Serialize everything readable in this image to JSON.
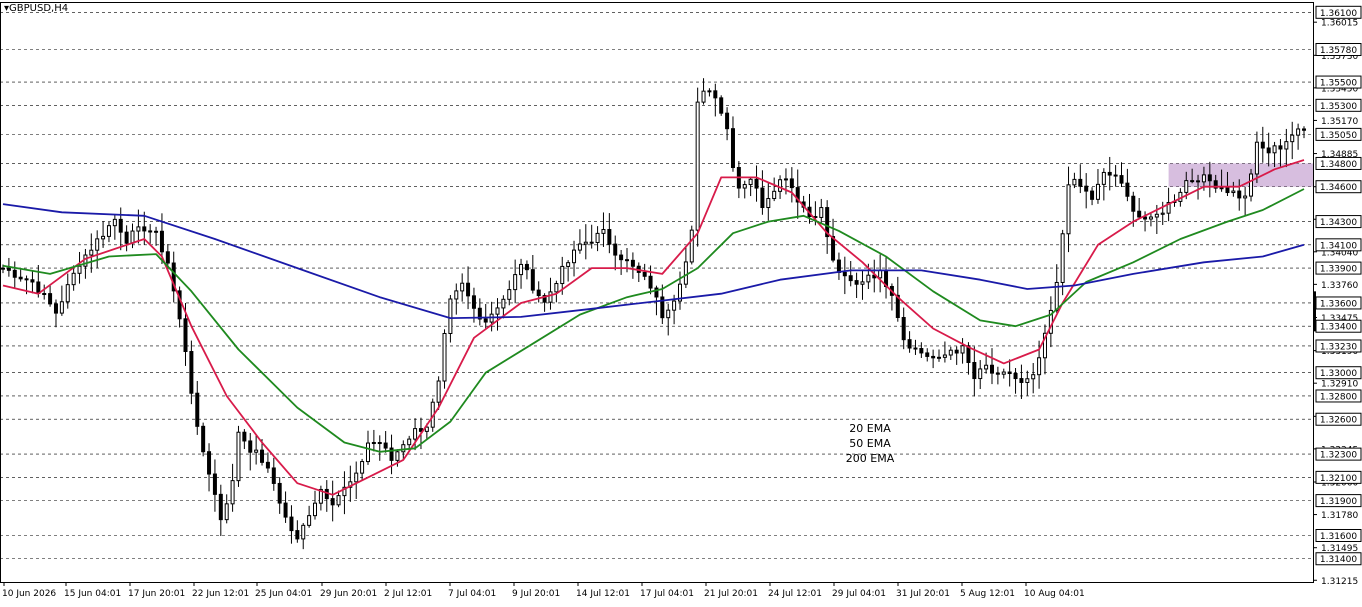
{
  "symbol": "GBPUSD,H4",
  "colors": {
    "background": "#ffffff",
    "candle": "#000000",
    "ema20": "#d81b4a",
    "ema50": "#1f8a1f",
    "ema200": "#1a1aa8",
    "grid": "#000000",
    "zone": "#c9a8d4",
    "price_badge_bg": "#ffffff"
  },
  "chart_data": {
    "type": "line",
    "subtype": "candlestick",
    "x_axis": {
      "type": "time",
      "ticks": [
        "10 Jun 2026",
        "15 Jun 04:01",
        "17 Jun 20:01",
        "22 Jun 12:01",
        "25 Jun 04:01",
        "29 Jun 20:01",
        "2 Jul 12:01",
        "7 Jul 04:01",
        "9 Jul 20:01",
        "14 Jul 12:01",
        "17 Jul 04:01",
        "21 Jul 20:01",
        "24 Jul 12:01",
        "29 Jul 04:01",
        "31 Jul 20:01",
        "5 Aug 12:01",
        "10 Aug 04:01"
      ]
    },
    "y_axis": {
      "range": [
        1.312,
        1.3618
      ],
      "tick_labels": [
        1.36015,
        1.3573,
        1.3545,
        1.3517,
        1.34885,
        1.346,
        1.3432,
        1.3404,
        1.3376,
        1.33475,
        1.3319,
        1.3291,
        1.32625,
        1.32345,
        1.3206,
        1.3178,
        1.31495,
        1.31215
      ],
      "tick_label_text": [
        "1.36015",
        "1.35730",
        "1.35450",
        "1.35170",
        "1.34885",
        "1.34600",
        "1.34320",
        "1.34040",
        "1.33760",
        "1.33475",
        "1.33190",
        "1.32910",
        "1.32625",
        "1.32345",
        "1.32060",
        "1.31780",
        "1.31495",
        "1.31215"
      ]
    },
    "horizontal_levels": [
      1.361,
      1.3578,
      1.355,
      1.353,
      1.3505,
      1.348,
      1.346,
      1.343,
      1.341,
      1.339,
      1.336,
      1.334,
      1.3323,
      1.33,
      1.328,
      1.326,
      1.323,
      1.321,
      1.319,
      1.316,
      1.314
    ],
    "horizontal_level_labels": [
      "1.36100",
      "1.35780",
      "1.35500",
      "1.35300",
      "1.35050",
      "1.34800",
      "1.34600",
      "1.34300",
      "1.34100",
      "1.33900",
      "1.33600",
      "1.33400",
      "1.33230",
      "1.33000",
      "1.32800",
      "1.32600",
      "1.32300",
      "1.32100",
      "1.31900",
      "1.31600",
      "1.31400"
    ],
    "zone": {
      "x_from": "5 Aug 00:00",
      "x_to": "11 Aug 16:00",
      "y_from": 1.346,
      "y_to": 1.348
    },
    "close_path": [
      [
        0,
        1.339
      ],
      [
        5,
        1.3378
      ],
      [
        9,
        1.3352
      ],
      [
        13,
        1.3395
      ],
      [
        17,
        1.342
      ],
      [
        19,
        1.3432
      ],
      [
        21,
        1.3415
      ],
      [
        24,
        1.3425
      ],
      [
        26,
        1.3418
      ],
      [
        28,
        1.3395
      ],
      [
        31,
        1.332
      ],
      [
        33,
        1.325
      ],
      [
        35,
        1.3215
      ],
      [
        37,
        1.3175
      ],
      [
        39,
        1.3205
      ],
      [
        40,
        1.325
      ],
      [
        42,
        1.3235
      ],
      [
        44,
        1.3225
      ],
      [
        46,
        1.3205
      ],
      [
        48,
        1.3175
      ],
      [
        50,
        1.3155
      ],
      [
        52,
        1.318
      ],
      [
        54,
        1.32
      ],
      [
        56,
        1.319
      ],
      [
        58,
        1.32
      ],
      [
        60,
        1.321
      ],
      [
        62,
        1.324
      ],
      [
        64,
        1.324
      ],
      [
        66,
        1.3225
      ],
      [
        68,
        1.324
      ],
      [
        70,
        1.325
      ],
      [
        72,
        1.3255
      ],
      [
        74,
        1.329
      ],
      [
        75,
        1.333
      ],
      [
        76,
        1.336
      ],
      [
        78,
        1.3375
      ],
      [
        80,
        1.3355
      ],
      [
        82,
        1.3345
      ],
      [
        84,
        1.3358
      ],
      [
        86,
        1.337
      ],
      [
        88,
        1.3395
      ],
      [
        90,
        1.3375
      ],
      [
        92,
        1.336
      ],
      [
        94,
        1.338
      ],
      [
        96,
        1.3395
      ],
      [
        98,
        1.341
      ],
      [
        100,
        1.3415
      ],
      [
        102,
        1.342
      ],
      [
        104,
        1.3405
      ],
      [
        106,
        1.3395
      ],
      [
        108,
        1.3385
      ],
      [
        110,
        1.3375
      ],
      [
        112,
        1.335
      ],
      [
        114,
        1.3365
      ],
      [
        116,
        1.3395
      ],
      [
        117,
        1.342
      ],
      [
        118,
        1.353
      ],
      [
        119,
        1.3545
      ],
      [
        121,
        1.354
      ],
      [
        123,
        1.351
      ],
      [
        124,
        1.348
      ],
      [
        125,
        1.346
      ],
      [
        127,
        1.3468
      ],
      [
        129,
        1.3445
      ],
      [
        131,
        1.346
      ],
      [
        133,
        1.347
      ],
      [
        135,
        1.345
      ],
      [
        137,
        1.3435
      ],
      [
        139,
        1.344
      ],
      [
        141,
        1.3395
      ],
      [
        143,
        1.338
      ],
      [
        145,
        1.3375
      ],
      [
        147,
        1.3385
      ],
      [
        149,
        1.3385
      ],
      [
        151,
        1.337
      ],
      [
        153,
        1.333
      ],
      [
        155,
        1.332
      ],
      [
        157,
        1.3315
      ],
      [
        159,
        1.331
      ],
      [
        161,
        1.332
      ],
      [
        163,
        1.332
      ],
      [
        165,
        1.3295
      ],
      [
        167,
        1.3305
      ],
      [
        169,
        1.3295
      ],
      [
        171,
        1.33
      ],
      [
        173,
        1.329
      ],
      [
        175,
        1.3295
      ],
      [
        177,
        1.333
      ],
      [
        179,
        1.3375
      ],
      [
        180,
        1.342
      ],
      [
        181,
        1.3465
      ],
      [
        183,
        1.346
      ],
      [
        185,
        1.345
      ],
      [
        187,
        1.347
      ],
      [
        189,
        1.347
      ],
      [
        191,
        1.345
      ],
      [
        193,
        1.3435
      ],
      [
        195,
        1.343
      ],
      [
        197,
        1.344
      ],
      [
        199,
        1.345
      ],
      [
        201,
        1.3465
      ],
      [
        203,
        1.3468
      ],
      [
        205,
        1.3465
      ],
      [
        207,
        1.346
      ],
      [
        209,
        1.3455
      ],
      [
        211,
        1.345
      ],
      [
        213,
        1.3495
      ],
      [
        215,
        1.349
      ],
      [
        217,
        1.3495
      ],
      [
        219,
        1.3505
      ],
      [
        221,
        1.3508
      ]
    ],
    "series": [
      {
        "name": "20 EMA",
        "color": "#d81b4a",
        "values": [
          [
            0,
            1.3375
          ],
          [
            6,
            1.3368
          ],
          [
            14,
            1.3398
          ],
          [
            24,
            1.3415
          ],
          [
            27,
            1.34
          ],
          [
            32,
            1.334
          ],
          [
            38,
            1.328
          ],
          [
            44,
            1.324
          ],
          [
            50,
            1.3205
          ],
          [
            56,
            1.3195
          ],
          [
            62,
            1.321
          ],
          [
            68,
            1.3225
          ],
          [
            74,
            1.327
          ],
          [
            80,
            1.333
          ],
          [
            88,
            1.336
          ],
          [
            94,
            1.3368
          ],
          [
            100,
            1.339
          ],
          [
            106,
            1.339
          ],
          [
            112,
            1.3385
          ],
          [
            118,
            1.342
          ],
          [
            122,
            1.3468
          ],
          [
            128,
            1.3468
          ],
          [
            134,
            1.3455
          ],
          [
            140,
            1.342
          ],
          [
            146,
            1.3395
          ],
          [
            152,
            1.3365
          ],
          [
            158,
            1.3338
          ],
          [
            164,
            1.3322
          ],
          [
            170,
            1.3308
          ],
          [
            176,
            1.332
          ],
          [
            180,
            1.336
          ],
          [
            186,
            1.341
          ],
          [
            192,
            1.343
          ],
          [
            198,
            1.3445
          ],
          [
            204,
            1.346
          ],
          [
            210,
            1.346
          ],
          [
            216,
            1.3475
          ],
          [
            221,
            1.3483
          ]
        ]
      },
      {
        "name": "50 EMA",
        "color": "#1f8a1f",
        "values": [
          [
            0,
            1.3392
          ],
          [
            8,
            1.3385
          ],
          [
            18,
            1.34
          ],
          [
            26,
            1.3402
          ],
          [
            32,
            1.337
          ],
          [
            40,
            1.332
          ],
          [
            50,
            1.327
          ],
          [
            58,
            1.324
          ],
          [
            64,
            1.3232
          ],
          [
            70,
            1.3235
          ],
          [
            76,
            1.3258
          ],
          [
            82,
            1.33
          ],
          [
            90,
            1.3325
          ],
          [
            98,
            1.335
          ],
          [
            106,
            1.3365
          ],
          [
            112,
            1.3372
          ],
          [
            118,
            1.339
          ],
          [
            124,
            1.342
          ],
          [
            130,
            1.343
          ],
          [
            136,
            1.3435
          ],
          [
            142,
            1.3422
          ],
          [
            150,
            1.34
          ],
          [
            158,
            1.337
          ],
          [
            166,
            1.3345
          ],
          [
            172,
            1.334
          ],
          [
            178,
            1.335
          ],
          [
            184,
            1.3378
          ],
          [
            192,
            1.3395
          ],
          [
            200,
            1.3415
          ],
          [
            208,
            1.343
          ],
          [
            214,
            1.344
          ],
          [
            221,
            1.3458
          ]
        ]
      },
      {
        "name": "200 EMA",
        "color": "#1a1aa8",
        "values": [
          [
            0,
            1.3445
          ],
          [
            10,
            1.3438
          ],
          [
            24,
            1.3435
          ],
          [
            36,
            1.3415
          ],
          [
            50,
            1.339
          ],
          [
            64,
            1.3365
          ],
          [
            76,
            1.3347
          ],
          [
            88,
            1.3348
          ],
          [
            100,
            1.3355
          ],
          [
            112,
            1.3362
          ],
          [
            122,
            1.3368
          ],
          [
            132,
            1.338
          ],
          [
            144,
            1.3388
          ],
          [
            156,
            1.3388
          ],
          [
            166,
            1.338
          ],
          [
            174,
            1.3372
          ],
          [
            182,
            1.3375
          ],
          [
            192,
            1.3385
          ],
          [
            204,
            1.3395
          ],
          [
            214,
            1.34
          ],
          [
            221,
            1.341
          ]
        ]
      }
    ],
    "legend": [
      "20 EMA",
      "50 EMA",
      "200 EMA"
    ],
    "legend_placement": "bottom-center",
    "grid": true
  }
}
